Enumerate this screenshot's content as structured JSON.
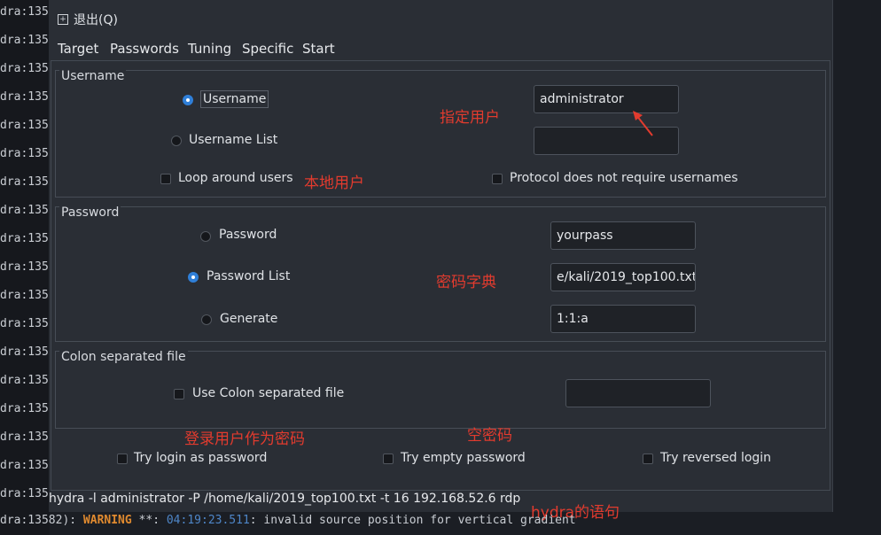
{
  "terminal": {
    "left_lines": [
      "dra:1358",
      "dra:135",
      "dra:135",
      "dra:135",
      "dra:135",
      "dra:135",
      "dra:135",
      "dra:135",
      "dra:135",
      "dra:135",
      "dra:135",
      "dra:135",
      "dra:135",
      "dra:135",
      "dra:135",
      "dra:135",
      "dra:135",
      "dra:135"
    ],
    "bottom": {
      "prefix": "dra:13582): ",
      "warning": "WARNING",
      "stars": " **: ",
      "timestamp": "04:19:23.511",
      "message": ": invalid source position for vertical gradient"
    }
  },
  "menu": {
    "exit_label": "退出(Q)",
    "exit_icon": "square-plus-icon"
  },
  "tabs": [
    "Target",
    "Passwords",
    "Tuning",
    "Specific",
    "Start"
  ],
  "active_tab": "Passwords",
  "username_group": {
    "title": "Username",
    "username_label": "Username",
    "username_list_label": "Username List",
    "loop_label": "Loop around users",
    "protocol_label": "Protocol does not require usernames",
    "username_value": "administrator",
    "username_list_value": "",
    "username_selected": true
  },
  "password_group": {
    "title": "Password",
    "password_label": "Password",
    "password_list_label": "Password List",
    "generate_label": "Generate",
    "password_value": "yourpass",
    "password_list_value": "​e/kali/2019_top100.txt",
    "generate_value": "1:1:a",
    "password_list_selected": true
  },
  "colon_group": {
    "title": "Colon separated file",
    "use_label": "Use Colon separated file",
    "file_value": ""
  },
  "options": {
    "try_login": "Try login as password",
    "try_empty": "Try empty password",
    "try_reversed": "Try reversed login"
  },
  "command": "hydra -l administrator -P /home/kali/2019_top100.txt -t 16 192.168.52.6 rdp",
  "annotations": {
    "specify_user": "指定用户",
    "local_user": "本地用户",
    "password_dict": "密码字典",
    "login_as_password": "登录用户作为密码",
    "empty_password": "空密码",
    "hydra_statement": "hydra的语句"
  },
  "colors": {
    "accent": "#3d8ee0",
    "annotation": "#e23b2e",
    "warning": "#e08a2f",
    "timestamp": "#4e86c8"
  }
}
